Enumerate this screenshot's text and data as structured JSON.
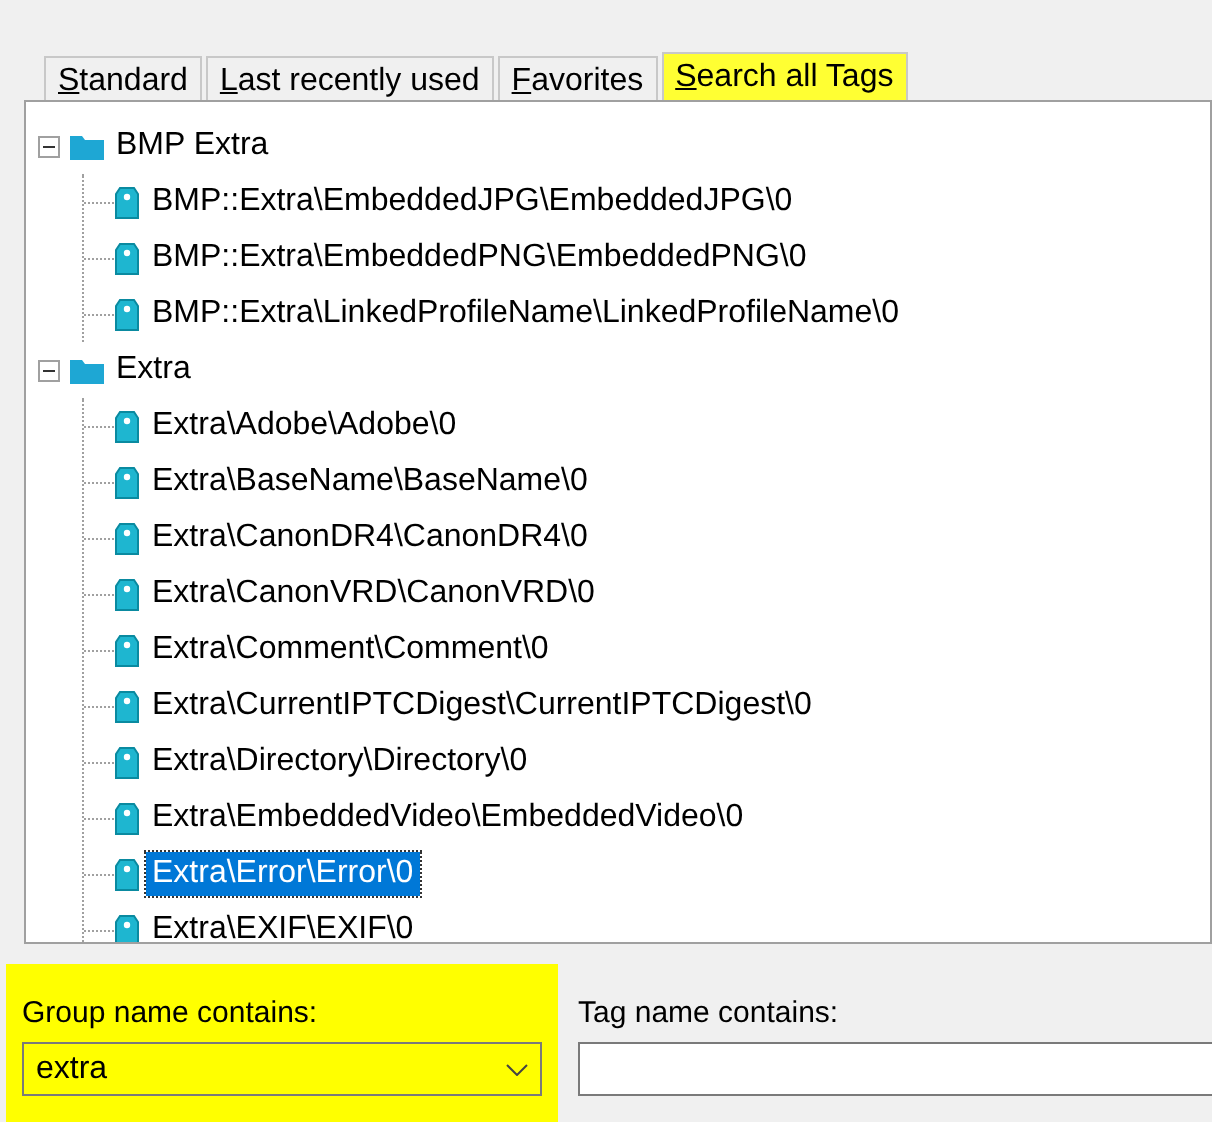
{
  "tabs": [
    {
      "label": "Standard",
      "selected": false,
      "highlighted": false
    },
    {
      "label": "Last recently used",
      "selected": false,
      "highlighted": false
    },
    {
      "label": "Favorites",
      "selected": false,
      "highlighted": false
    },
    {
      "label": "Search all Tags",
      "selected": true,
      "highlighted": true
    }
  ],
  "tree": [
    {
      "label": "BMP Extra",
      "expanded": true,
      "children": [
        {
          "label": "BMP::Extra\\EmbeddedJPG\\EmbeddedJPG\\0",
          "selected": false
        },
        {
          "label": "BMP::Extra\\EmbeddedPNG\\EmbeddedPNG\\0",
          "selected": false
        },
        {
          "label": "BMP::Extra\\LinkedProfileName\\LinkedProfileName\\0",
          "selected": false
        }
      ]
    },
    {
      "label": "Extra",
      "expanded": true,
      "children": [
        {
          "label": "Extra\\Adobe\\Adobe\\0",
          "selected": false
        },
        {
          "label": "Extra\\BaseName\\BaseName\\0",
          "selected": false
        },
        {
          "label": "Extra\\CanonDR4\\CanonDR4\\0",
          "selected": false
        },
        {
          "label": "Extra\\CanonVRD\\CanonVRD\\0",
          "selected": false
        },
        {
          "label": "Extra\\Comment\\Comment\\0",
          "selected": false
        },
        {
          "label": "Extra\\CurrentIPTCDigest\\CurrentIPTCDigest\\0",
          "selected": false
        },
        {
          "label": "Extra\\Directory\\Directory\\0",
          "selected": false
        },
        {
          "label": "Extra\\EmbeddedVideo\\EmbeddedVideo\\0",
          "selected": false
        },
        {
          "label": "Extra\\Error\\Error\\0",
          "selected": true
        },
        {
          "label": "Extra\\EXIF\\EXIF\\0",
          "selected": false
        }
      ]
    }
  ],
  "group_filter": {
    "label": "Group name contains:",
    "value": "extra",
    "highlighted": true
  },
  "tag_filter": {
    "label": "Tag name contains:"
  }
}
